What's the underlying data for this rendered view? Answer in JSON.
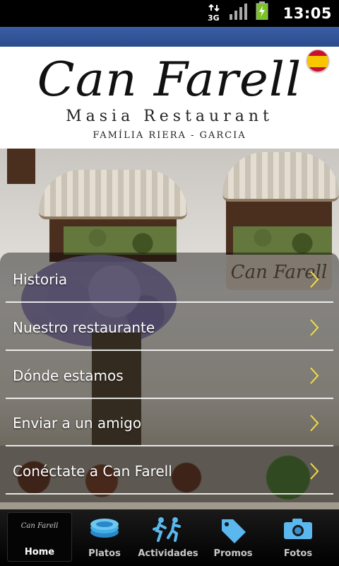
{
  "status_bar": {
    "time": "13:05",
    "network_label": "3G",
    "icons": [
      "data-transfer-icon",
      "signal-strength-icon",
      "battery-charging-icon"
    ]
  },
  "header": {
    "logo_title": "Can Farell",
    "logo_subtitle": "Masia Restaurant",
    "logo_family": "FAMÍLIA RIERA - GARCIA",
    "language_flag": "spain-flag-icon"
  },
  "photo": {
    "sign_text": "Can Farell"
  },
  "menu": {
    "items": [
      {
        "label": "Historia"
      },
      {
        "label": "Nuestro restaurante"
      },
      {
        "label": "Dónde estamos"
      },
      {
        "label": "Enviar a un amigo"
      },
      {
        "label": "Conéctate a Can Farell"
      }
    ],
    "chevron_color": "#f0e040"
  },
  "tabbar": {
    "home_logo": "Can Farell",
    "tabs": [
      {
        "label": "Home",
        "icon": "home-logo-icon",
        "active": true
      },
      {
        "label": "Platos",
        "icon": "plates-icon",
        "active": false
      },
      {
        "label": "Actividades",
        "icon": "activities-icon",
        "active": false
      },
      {
        "label": "Promos",
        "icon": "tag-icon",
        "active": false
      },
      {
        "label": "Fotos",
        "icon": "camera-icon",
        "active": false
      }
    ]
  }
}
